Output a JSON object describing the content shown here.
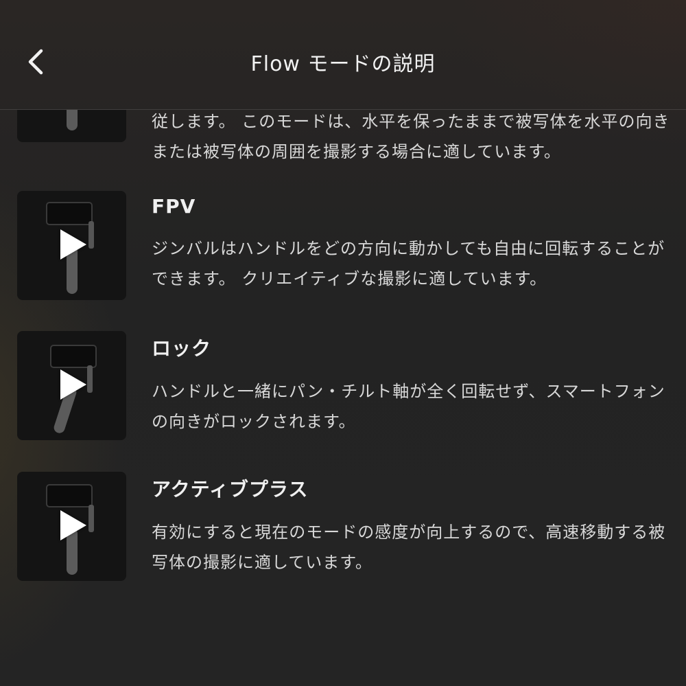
{
  "header": {
    "title": "Flow モードの説明",
    "back_icon": "chevron-left-icon"
  },
  "items": [
    {
      "title": "",
      "description": "従します。 このモードは、水平を保ったままで被写体を水平の向きまたは被写体の周囲を撮影する場合に適しています。"
    },
    {
      "title": "FPV",
      "description": "ジンバルはハンドルをどの方向に動かしても自由に回転することができます。 クリエイティブな撮影に適しています。"
    },
    {
      "title": "ロック",
      "description": "ハンドルと一緒にパン・チルト軸が全く回転せず、スマートフォンの向きがロックされます。"
    },
    {
      "title": "アクティブプラス",
      "description": "有効にすると現在のモードの感度が向上するので、高速移動する被写体の撮影に適しています。"
    }
  ],
  "colors": {
    "background": "#232323",
    "thumbnail": "#141414",
    "text": "#d8d8d8"
  }
}
